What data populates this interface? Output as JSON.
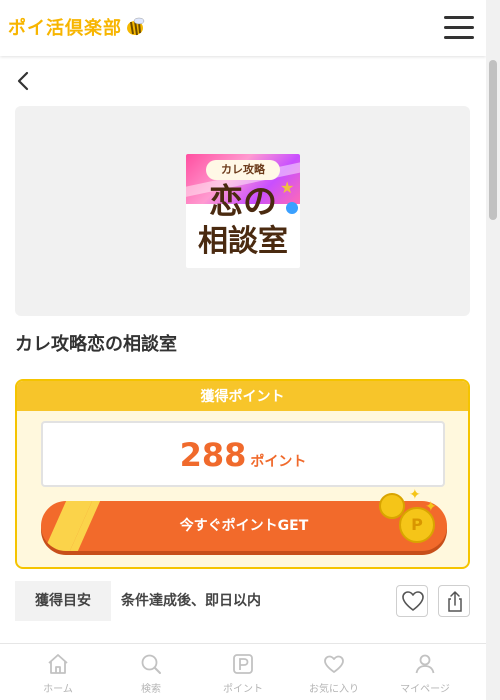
{
  "header": {
    "logo_text": "ポイ活倶楽部",
    "logo_icon": "bee-icon",
    "menu_icon": "hamburger-menu-icon"
  },
  "nav": {
    "back_icon": "chevron-left-icon"
  },
  "offer": {
    "image": {
      "sub": "カレ攻略",
      "line1": "恋の",
      "line2": "相談室"
    },
    "title": "カレ攻略恋の相談室"
  },
  "points": {
    "header": "獲得ポイント",
    "value": "288",
    "unit": "ポイント",
    "button_label": "今すぐポイントGET",
    "coin_mark": "P"
  },
  "guide": {
    "label": "獲得目安",
    "text": "条件達成後、即日以内"
  },
  "bottom_nav": [
    {
      "label": "ホーム",
      "icon": "home-icon"
    },
    {
      "label": "検索",
      "icon": "search-icon"
    },
    {
      "label": "ポイント",
      "icon": "point-icon"
    },
    {
      "label": "お気に入り",
      "icon": "heart-icon"
    },
    {
      "label": "マイページ",
      "icon": "user-icon"
    }
  ],
  "colors": {
    "accent_orange": "#f26a2b",
    "accent_yellow": "#f7c52a",
    "logo_yellow": "#f7b500"
  }
}
